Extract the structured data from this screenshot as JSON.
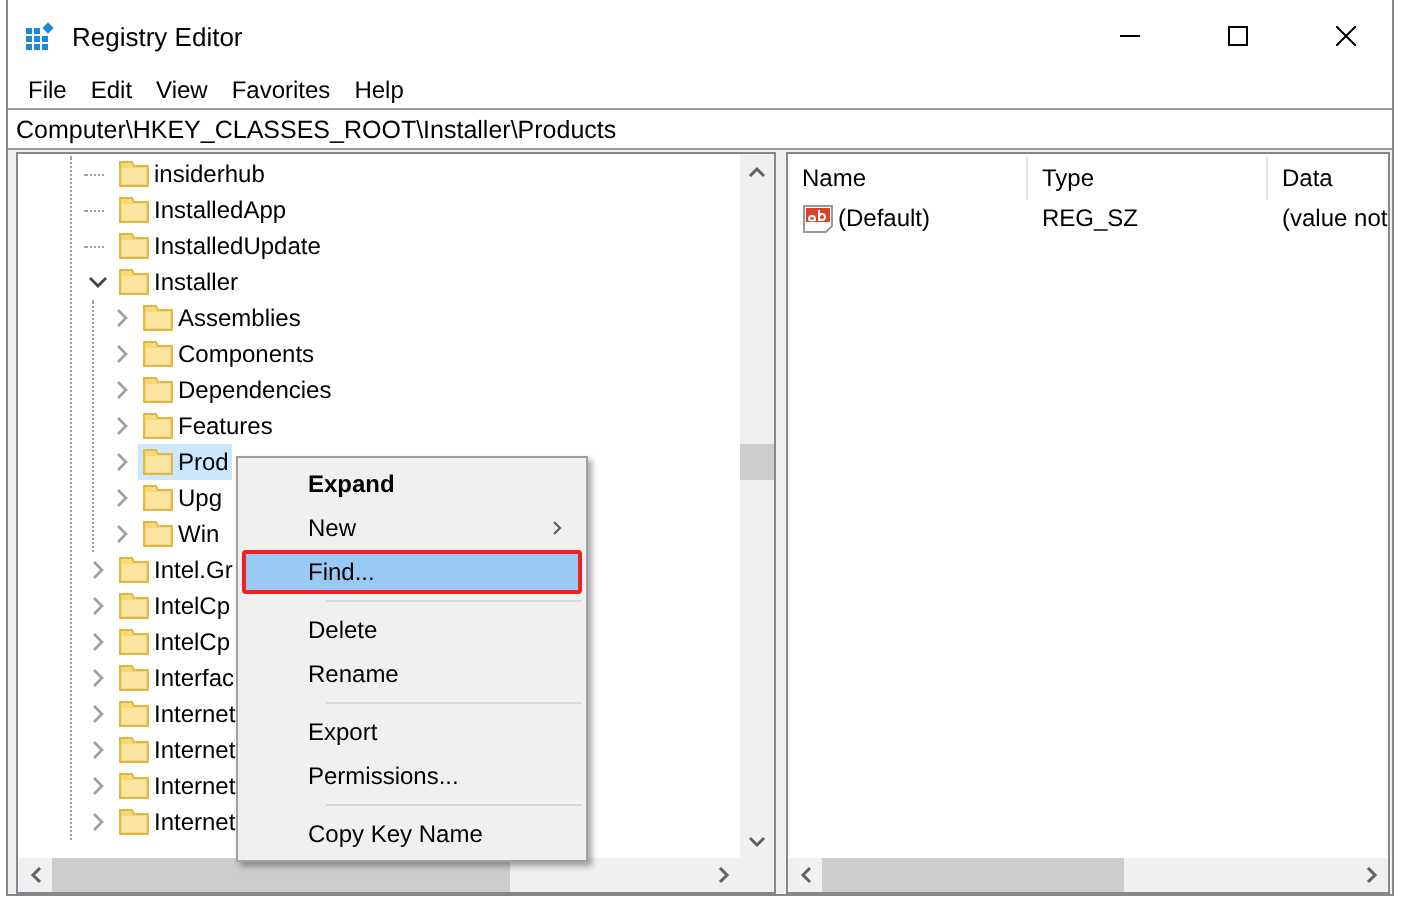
{
  "window": {
    "title": "Registry Editor"
  },
  "menu_bar": [
    "File",
    "Edit",
    "View",
    "Favorites",
    "Help"
  ],
  "address": "Computer\\HKEY_CLASSES_ROOT\\Installer\\Products",
  "tree": [
    {
      "label": "insiderhub",
      "kind": "leaf",
      "selected": false
    },
    {
      "label": "InstalledApp",
      "kind": "leaf",
      "selected": false
    },
    {
      "label": "InstalledUpdate",
      "kind": "leaf",
      "selected": false
    },
    {
      "label": "Installer",
      "kind": "expanded",
      "selected": false,
      "children": [
        {
          "label": "Assemblies",
          "kind": "collapsed",
          "selected": false
        },
        {
          "label": "Components",
          "kind": "collapsed",
          "selected": false
        },
        {
          "label": "Dependencies",
          "kind": "collapsed",
          "selected": false
        },
        {
          "label": "Features",
          "kind": "collapsed",
          "selected": false
        },
        {
          "label": "Prod",
          "kind": "collapsed",
          "selected": true
        },
        {
          "label": "Upg",
          "kind": "collapsed",
          "selected": false
        },
        {
          "label": "Win",
          "kind": "collapsed",
          "selected": false
        }
      ]
    },
    {
      "label": "Intel.Gr",
      "kind": "collapsed",
      "selected": false
    },
    {
      "label": "IntelCp",
      "kind": "collapsed",
      "selected": false
    },
    {
      "label": "IntelCp",
      "kind": "collapsed",
      "selected": false
    },
    {
      "label": "Interfac",
      "kind": "collapsed",
      "selected": false
    },
    {
      "label": "Internet",
      "kind": "collapsed",
      "selected": false
    },
    {
      "label": "Internet",
      "kind": "collapsed",
      "selected": false
    },
    {
      "label": "Internet",
      "kind": "collapsed",
      "selected": false
    },
    {
      "label": "Internet",
      "kind": "collapsed",
      "selected": false
    }
  ],
  "values": {
    "columns": [
      "Name",
      "Type",
      "Data"
    ],
    "rows": [
      {
        "name": "(Default)",
        "type": "REG_SZ",
        "data": "(value not"
      }
    ]
  },
  "context_menu": [
    {
      "kind": "item",
      "label": "Expand",
      "bold": true,
      "submenu": false,
      "selected": false
    },
    {
      "kind": "item",
      "label": "New",
      "bold": false,
      "submenu": true,
      "selected": false
    },
    {
      "kind": "item",
      "label": "Find...",
      "bold": false,
      "submenu": false,
      "selected": true
    },
    {
      "kind": "separator"
    },
    {
      "kind": "item",
      "label": "Delete",
      "bold": false,
      "submenu": false,
      "selected": false
    },
    {
      "kind": "item",
      "label": "Rename",
      "bold": false,
      "submenu": false,
      "selected": false
    },
    {
      "kind": "separator"
    },
    {
      "kind": "item",
      "label": "Export",
      "bold": false,
      "submenu": false,
      "selected": false
    },
    {
      "kind": "item",
      "label": "Permissions...",
      "bold": false,
      "submenu": false,
      "selected": false
    },
    {
      "kind": "separator"
    },
    {
      "kind": "item",
      "label": "Copy Key Name",
      "bold": false,
      "submenu": false,
      "selected": false
    }
  ]
}
